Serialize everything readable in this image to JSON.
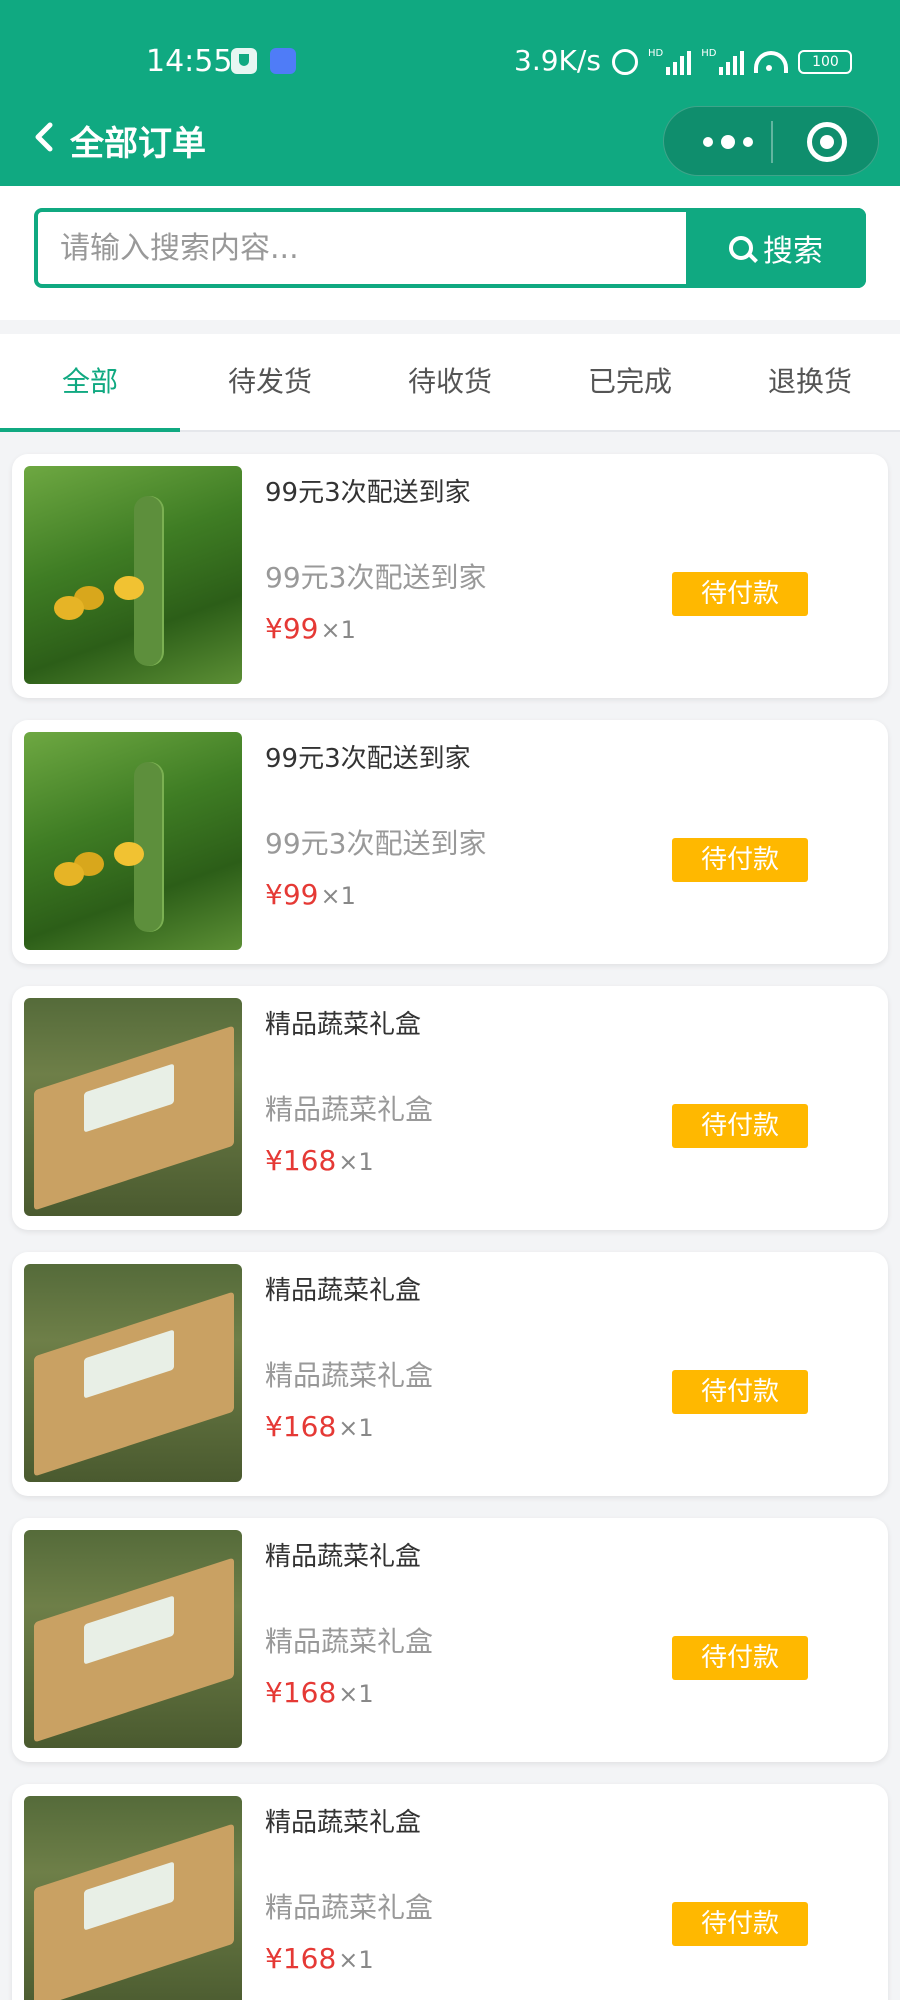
{
  "status_bar": {
    "time": "14:55",
    "net_speed": "3.9K/s",
    "hd1": "HD",
    "hd2": "HD",
    "battery": "100"
  },
  "nav": {
    "title": "全部订单"
  },
  "search": {
    "placeholder": "请输入搜索内容...",
    "button_label": "搜索"
  },
  "tabs": [
    {
      "label": "全部",
      "active": true
    },
    {
      "label": "待发货",
      "active": false
    },
    {
      "label": "待收货",
      "active": false
    },
    {
      "label": "已完成",
      "active": false
    },
    {
      "label": "退换货",
      "active": false
    }
  ],
  "orders": [
    {
      "image": "cucumber",
      "name": "99元3次配送到家",
      "subtitle": "99元3次配送到家",
      "price": "¥99",
      "qty": "×1",
      "status": "待付款"
    },
    {
      "image": "cucumber",
      "name": "99元3次配送到家",
      "subtitle": "99元3次配送到家",
      "price": "¥99",
      "qty": "×1",
      "status": "待付款"
    },
    {
      "image": "giftbox",
      "name": "精品蔬菜礼盒",
      "subtitle": "精品蔬菜礼盒",
      "price": "¥168",
      "qty": "×1",
      "status": "待付款"
    },
    {
      "image": "giftbox",
      "name": "精品蔬菜礼盒",
      "subtitle": "精品蔬菜礼盒",
      "price": "¥168",
      "qty": "×1",
      "status": "待付款"
    },
    {
      "image": "giftbox",
      "name": "精品蔬菜礼盒",
      "subtitle": "精品蔬菜礼盒",
      "price": "¥168",
      "qty": "×1",
      "status": "待付款"
    },
    {
      "image": "giftbox",
      "name": "精品蔬菜礼盒",
      "subtitle": "精品蔬菜礼盒",
      "price": "¥168",
      "qty": "×1",
      "status": "待付款"
    }
  ],
  "colors": {
    "brand": "#10a981",
    "price": "#e53935",
    "badge": "#ffb800"
  }
}
